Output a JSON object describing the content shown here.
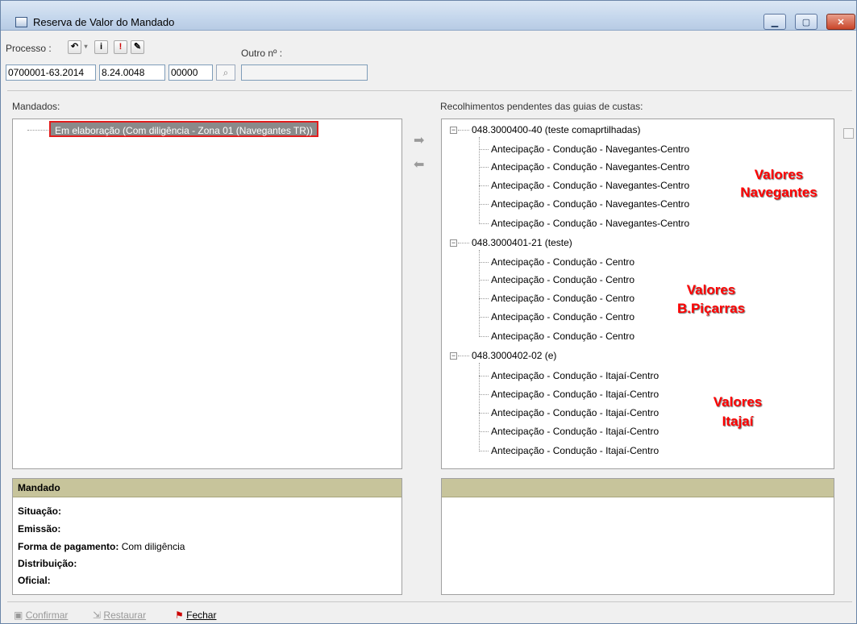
{
  "window": {
    "title": "Reserva de Valor do Mandado",
    "controls": [
      "minimize",
      "maximize",
      "close"
    ]
  },
  "processo": {
    "label": "Processo :",
    "part1": "0700001-63.2014",
    "part2": "8.24.0048",
    "part3": "00000",
    "outro_label": "Outro nº :",
    "outro_value": ""
  },
  "mandados": {
    "label": "Mandados:",
    "items": [
      "Em elaboração (Com diligência - Zona 01 (Navegantes TR))"
    ]
  },
  "recolhimentos": {
    "label": "Recolhimentos pendentes das guias de custas:",
    "groups": [
      {
        "title": "048.3000400-40 (teste comaprtilhadas)",
        "items": [
          "Antecipação - Condução - Navegantes-Centro",
          "Antecipação - Condução - Navegantes-Centro",
          "Antecipação - Condução - Navegantes-Centro",
          "Antecipação - Condução - Navegantes-Centro",
          "Antecipação - Condução - Navegantes-Centro"
        ]
      },
      {
        "title": "048.3000401-21 (teste)",
        "items": [
          "Antecipação - Condução - Centro",
          "Antecipação - Condução - Centro",
          "Antecipação - Condução - Centro",
          "Antecipação - Condução - Centro",
          "Antecipação - Condução - Centro"
        ]
      },
      {
        "title": "048.3000402-02 (e)",
        "items": [
          "Antecipação - Condução - Itajaí-Centro",
          "Antecipação - Condução - Itajaí-Centro",
          "Antecipação - Condução - Itajaí-Centro",
          "Antecipação - Condução - Itajaí-Centro",
          "Antecipação - Condução - Itajaí-Centro"
        ]
      }
    ]
  },
  "annotations": {
    "navegantes_1": "Valores",
    "navegantes_2": "Navegantes",
    "picarras_1": "Valores",
    "picarras_2": "B.Piçarras",
    "itajai_1": "Valores",
    "itajai_2": "Itajaí",
    "color": "#ff0000"
  },
  "mandado_detail": {
    "header": "Mandado",
    "situacao_label": "Situação:",
    "situacao_value": "",
    "emissao_label": "Emissão:",
    "emissao_value": "",
    "forma_label": "Forma de pagamento:",
    "forma_value": "Com diligência",
    "distribuicao_label": "Distribuição:",
    "distribuicao_value": "",
    "oficial_label": "Oficial:",
    "oficial_value": ""
  },
  "right_detail": {
    "header": ""
  },
  "footer": {
    "confirmar": "Confirmar",
    "restaurar": "Restaurar",
    "fechar": "Fechar"
  },
  "colors": {
    "detail_header": "#c7c49b",
    "selection_border": "#e21d1d"
  }
}
